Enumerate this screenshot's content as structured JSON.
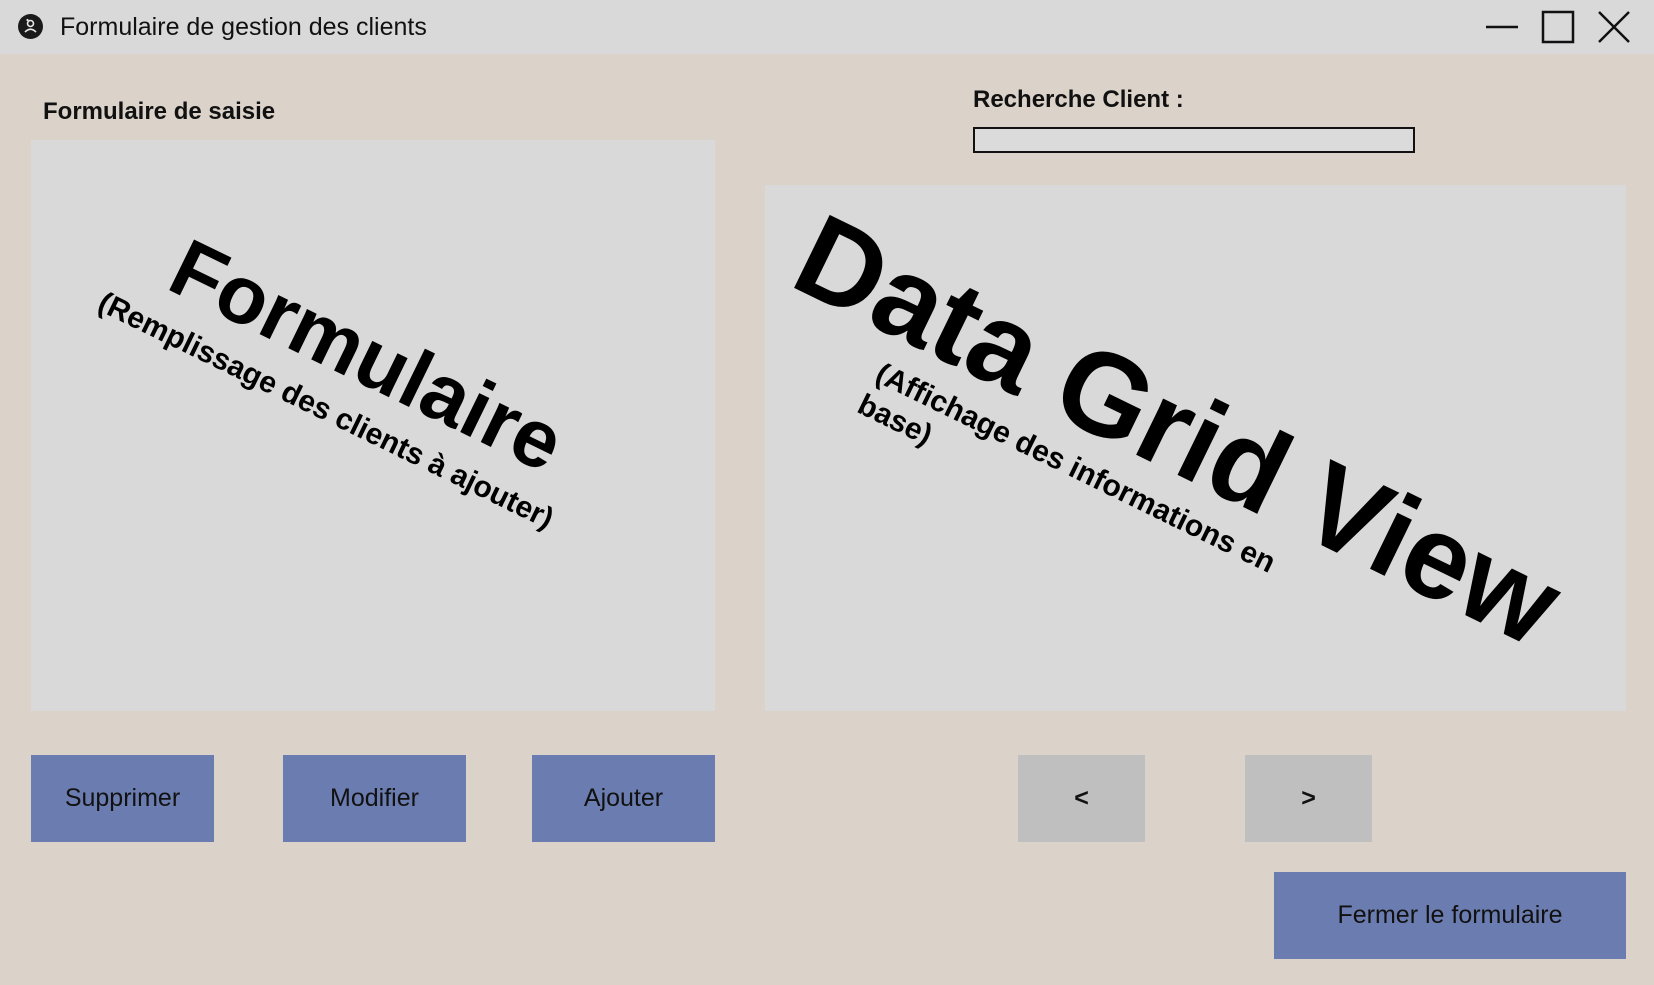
{
  "window": {
    "title": "Formulaire de gestion des clients",
    "icon": "app-icon",
    "controls": {
      "minimize_icon": "minimize-icon",
      "maximize_icon": "maximize-icon",
      "close_icon": "close-icon"
    }
  },
  "form_section": {
    "title": "Formulaire de saisie",
    "placeholder_main": "Formulaire",
    "placeholder_sub": "(Remplissage des clients à ajouter)"
  },
  "search": {
    "label": "Recherche Client :",
    "value": "",
    "placeholder": ""
  },
  "grid_section": {
    "placeholder_main": "Data Grid View",
    "placeholder_sub_line1": "(Affichage des informations en",
    "placeholder_sub_line2": "base)"
  },
  "actions": {
    "delete_label": "Supprimer",
    "edit_label": "Modifier",
    "add_label": "Ajouter",
    "close_form_label": "Fermer le formulaire"
  },
  "pagination": {
    "prev_label": "<",
    "next_label": ">"
  },
  "colors": {
    "background": "#dbd2c9",
    "titlebar": "#d9d9d9",
    "panel": "#d9d9d9",
    "primary_button": "#6b7db0",
    "secondary_button": "#bfbfbf"
  }
}
